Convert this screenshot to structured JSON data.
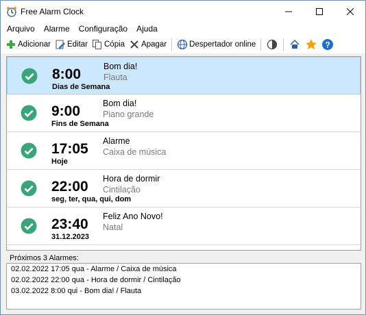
{
  "window": {
    "title": "Free Alarm Clock"
  },
  "menu": [
    "Arquivo",
    "Alarme",
    "Configuração",
    "Ajuda"
  ],
  "toolbar": {
    "add": "Adicionar",
    "edit": "Editar",
    "copy": "Cópia",
    "delete": "Apagar",
    "online": "Despertador online"
  },
  "alarms": [
    {
      "time": "8:00",
      "days": "Dias de Semana",
      "label": "Bom dia!",
      "sound": "Flauta",
      "enabled": true,
      "selected": true
    },
    {
      "time": "9:00",
      "days": "Fins de Semana",
      "label": "Bom dia!",
      "sound": "Piano grande",
      "enabled": true,
      "selected": false
    },
    {
      "time": "17:05",
      "days": "Hoje",
      "label": "Alarme",
      "sound": "Caixa de música",
      "enabled": true,
      "selected": false
    },
    {
      "time": "22:00",
      "days": "seg, ter, qua, qui, dom",
      "label": "Hora de dormir",
      "sound": "Cintilação",
      "enabled": true,
      "selected": false
    },
    {
      "time": "23:40",
      "days": "31.12.2023",
      "label": "Feliz Ano Novo!",
      "sound": "Natal",
      "enabled": true,
      "selected": false
    }
  ],
  "next": {
    "title": "Próximos 3 Alarmes:",
    "items": [
      "02.02.2022 17:05 qua - Alarme / Caixa de música",
      "02.02.2022 22:00 qua - Hora de dormir / Cintilação",
      "03.02.2022 8:00 qui - Bom dia! / Flauta"
    ]
  },
  "colors": {
    "check": "#3aa57a",
    "selected_bg": "#cce8ff",
    "accent_star": "#f0a30a",
    "help": "#1f6fd1"
  }
}
